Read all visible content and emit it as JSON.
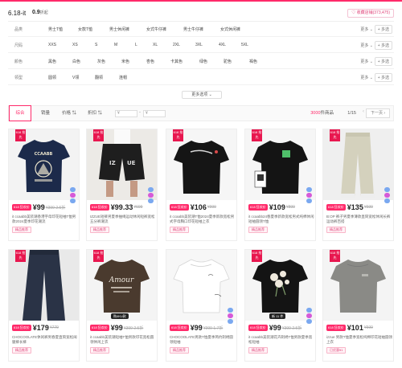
{
  "header": {
    "date": "6.18-it",
    "promo": "0.9",
    "promo_sub": "折起",
    "fav_label": "♡ 收藏店铺(373,475)"
  },
  "filters": {
    "rows": [
      {
        "label": "品类",
        "options": [
          "男士T恤",
          "女款T恤",
          "男士休闲裤",
          "女式牛仔裤",
          "男士牛仔裤",
          "女式休闲裤"
        ]
      },
      {
        "label": "尺码",
        "options": [
          "XXS",
          "XS",
          "S",
          "M",
          "L",
          "XL",
          "2XL",
          "3XL",
          "4XL",
          "5XL"
        ]
      },
      {
        "label": "颜色",
        "options": [
          "黑色",
          "白色",
          "灰色",
          "米色",
          "杏色",
          "卡其色",
          "绿色",
          "驼色",
          "褐色"
        ]
      },
      {
        "label": "领型",
        "options": [
          "圆领",
          "V领",
          "翻领",
          "连帽"
        ]
      }
    ],
    "more_label": "更多 ⌄",
    "multi_label": "+ 多选",
    "expand_label": "更多选项 ⌄"
  },
  "sort": {
    "tabs": [
      "综合",
      "销量",
      "价格 ⇅",
      "折扣 ⇅"
    ],
    "price_from": "¥",
    "price_dash": "-",
    "price_to": "¥",
    "count_num": "3000",
    "count_suffix": "件商品",
    "pager": "1/15",
    "prev": "‹",
    "next": "下一页 ›"
  },
  "products": [
    {
      "price": "¥99",
      "orig": "¥399 2.5折",
      "title": "it ccaabb美装潮香港字母印花短袖T恤男款2024夏季印花潮流",
      "badge": "精品推荐"
    },
    {
      "price": "¥99.33",
      "orig": "¥699",
      "title": "IZZUE短裤男夏季抽绳运动休闲短裤宽松五分裤潮流",
      "badge": "精品推荐"
    },
    {
      "price": "¥106",
      "orig": "¥999",
      "title": "it ccaabb美装潮T恤2024夏季新款宽松男式字母胸口印花短袖上衣",
      "badge": "精品推荐"
    },
    {
      "price": "¥109",
      "orig": "¥899",
      "title": "it ccaabb24春夏季新款宽松男式纯棉休闲短袖圆领T恤",
      "badge": "精品推荐"
    },
    {
      "price": "¥135",
      "orig": "¥699",
      "title": "B:OP 裤子男夏季薄款直筒宽松休闲长裤运动裤百搭",
      "badge": "精品推荐"
    },
    {
      "price": "¥179",
      "orig": "¥779",
      "title": "CHOCOOLATE休闲裤男春夏直筒宽松阔腿裤长裤",
      "badge": "精品推荐"
    },
    {
      "price": "¥99",
      "orig": "¥399 2.5折",
      "title": "it ccaabb美装潮短袖T恤男款印花宽松圆领休闲上衣",
      "badge": "精品推荐"
    },
    {
      "price": "¥99",
      "orig": "¥999 1.7折",
      "title": "CHOCOOLATE男款T恤夏季简约刺绣圆领短袖",
      "badge": "精品推荐"
    },
    {
      "price": "¥99",
      "orig": "¥399 2.5折",
      "title": "it ccaabb美装潮花卉刺绣T恤男款夏季宽松短袖",
      "badge": "精品推荐"
    },
    {
      "price": "¥101",
      "orig": "¥599",
      "title": "izzue 男款T恤夏季宽松纯棉印花短袖圆领上衣",
      "badge": "已优惠¥1"
    }
  ],
  "bubbles": {
    "img7": "购4KU款",
    "img9": "新 11 件"
  },
  "tag618": "618 狂欢价",
  "seal_label": "618 抢先",
  "colors": {
    "accent": "#ff2a6a",
    "badge_bg": "#fff2f6"
  }
}
